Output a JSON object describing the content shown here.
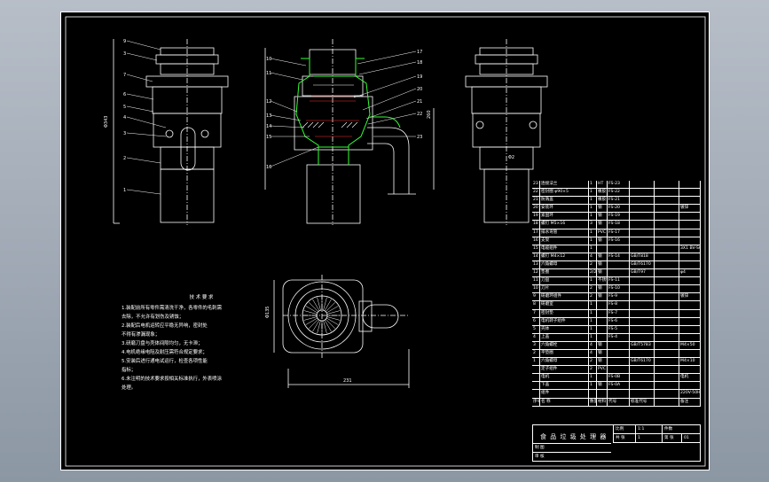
{
  "notes": {
    "title": "技 术 要 求",
    "lines": [
      "1.装配前所有零件需清洗干净，各零件的毛刺需",
      "去除，不允许有划伤及锈蚀；",
      "2.装配后电机运转应平稳无异响，密封处",
      "不得有渗漏现象；",
      "3.研磨刀盘与壳体间隙均匀，无卡滞；",
      "4.电机绝缘电阻及耐压需符合规定要求；",
      "5.安装后进行通电试运行，检查各项性能",
      "指标；",
      "6.未注明的技术要求按相关标准执行，外表喷涂",
      "处理。"
    ]
  },
  "bom": [
    {
      "no": "23",
      "name": "连接法兰",
      "qty": "1",
      "mat": "HT",
      "code": "FS-23",
      "std": "",
      "weight": "",
      "note": ""
    },
    {
      "no": "22",
      "name": "密封圈 φ90×5",
      "qty": "1",
      "mat": "橡胶",
      "code": "FS-22",
      "std": "",
      "weight": "",
      "note": ""
    },
    {
      "no": "21",
      "name": "防溅盖",
      "qty": "1",
      "mat": "橡胶",
      "code": "FS-21",
      "std": "",
      "weight": "",
      "note": ""
    },
    {
      "no": "20",
      "name": "安装环",
      "qty": "1",
      "mat": "钢",
      "code": "FS-20",
      "std": "",
      "weight": "",
      "note": "镀锌"
    },
    {
      "no": "19",
      "name": "紧固环",
      "qty": "1",
      "mat": "钢",
      "code": "FS-19",
      "std": "",
      "weight": "",
      "note": ""
    },
    {
      "no": "18",
      "name": "螺钉 M5×16",
      "qty": "3",
      "mat": "钢",
      "code": "FS-18",
      "std": "",
      "weight": "",
      "note": ""
    },
    {
      "no": "17",
      "name": "排水弯管",
      "qty": "1",
      "mat": "PVC",
      "code": "FS-17",
      "std": "",
      "weight": "",
      "note": ""
    },
    {
      "no": "16",
      "name": "支架",
      "qty": "1",
      "mat": "钢",
      "code": "FS-16",
      "std": "",
      "weight": "",
      "note": ""
    },
    {
      "no": "15",
      "name": "电缆组件",
      "qty": "1",
      "mat": "",
      "code": "",
      "std": "",
      "weight": "",
      "note": "3X1 BV-SGNTC"
    },
    {
      "no": "14",
      "name": "螺钉 M4×12",
      "qty": "4",
      "mat": "钢",
      "code": "FS-14",
      "std": "GB/T818",
      "weight": "",
      "note": ""
    },
    {
      "no": "13",
      "name": "六角螺母",
      "qty": "2",
      "mat": "钢",
      "code": "",
      "std": "GB/T6170",
      "weight": "",
      "note": ""
    },
    {
      "no": "12",
      "name": "垫圈",
      "qty": "2/2",
      "mat": "钢",
      "code": "",
      "std": "GB/T97",
      "weight": "",
      "note": "φ4"
    },
    {
      "no": "11",
      "name": "刀盘",
      "qty": "1",
      "mat": "不锈钢",
      "code": "FS-11",
      "std": "",
      "weight": "",
      "note": ""
    },
    {
      "no": "10",
      "name": "刀片",
      "qty": "2",
      "mat": "钢",
      "code": "FS-10",
      "std": "",
      "weight": "",
      "note": ""
    },
    {
      "no": "9",
      "name": "研磨环组件",
      "qty": "2",
      "mat": "钢",
      "code": "FS-9",
      "std": "",
      "weight": "",
      "note": "镀锌"
    },
    {
      "no": "8",
      "name": "研磨室",
      "qty": "1",
      "mat": "",
      "code": "FS-8",
      "std": "",
      "weight": "",
      "note": ""
    },
    {
      "no": "7",
      "name": "密封垫",
      "qty": "1",
      "mat": "",
      "code": "FS-7",
      "std": "",
      "weight": "",
      "note": ""
    },
    {
      "no": "6",
      "name": "电机转子组件",
      "qty": "1",
      "mat": "",
      "code": "FS-6",
      "std": "",
      "weight": "",
      "note": ""
    },
    {
      "no": "5",
      "name": "壳体",
      "qty": "1",
      "mat": "",
      "code": "FS-5",
      "std": "",
      "weight": "",
      "note": ""
    },
    {
      "no": "4",
      "name": "上盖",
      "qty": "1",
      "mat": "",
      "code": "FS-4",
      "std": "",
      "weight": "",
      "note": ""
    },
    {
      "no": "3",
      "name": "六角螺栓",
      "qty": "4",
      "mat": "钢",
      "code": "",
      "std": "GB/T5783",
      "weight": "",
      "note": "M4×50"
    },
    {
      "no": "2",
      "name": "平垫圈",
      "qty": "4",
      "mat": "钢",
      "code": "",
      "std": "",
      "weight": "",
      "note": ""
    },
    {
      "no": "1",
      "name": "六角螺母",
      "qty": "2",
      "mat": "钢",
      "code": "",
      "std": "GB/T6170",
      "weight": "",
      "note": "M4×10"
    },
    {
      "no": "",
      "name": "定子组件",
      "qty": "2",
      "mat": "PVC",
      "code": "",
      "std": "",
      "weight": "",
      "note": ""
    },
    {
      "no": "",
      "name": "电机",
      "qty": "1",
      "mat": "",
      "code": "FS-0B",
      "std": "",
      "weight": "",
      "note": "电机"
    },
    {
      "no": "",
      "name": "下盖",
      "qty": "1",
      "mat": "钢",
      "code": "FS-0A",
      "std": "",
      "weight": "",
      "note": ""
    },
    {
      "no": "",
      "name": "组件",
      "qty": "",
      "mat": "",
      "code": "",
      "std": "",
      "weight": "",
      "note": "220V-50Hz 370W"
    },
    {
      "no": "序号",
      "name": "名    称",
      "qty": "数量",
      "mat": "材料",
      "code": "代号",
      "std": "标准代号",
      "weight": "",
      "note": "备注"
    }
  ],
  "title_block": {
    "name": "食 品 垃 圾 处 理 器",
    "scale_label": "比例",
    "scale": "1:1",
    "sheet_label": "件数",
    "qty_label": "共  张",
    "qty": "1",
    "sheet_no_label": "第  张",
    "sheet_no": "01",
    "drawn": "制 图",
    "checked": "审 核"
  },
  "labels": {
    "left_view": [
      "9",
      "3",
      "7",
      "6",
      "5",
      "4",
      "3",
      "2",
      "1"
    ],
    "section": [
      "10",
      "11",
      "12",
      "13",
      "14",
      "15",
      "16",
      "17",
      "18",
      "19",
      "20",
      "21",
      "22",
      "23"
    ],
    "dim_height": "Φ343",
    "dim_top": "Φ135",
    "dim_width": "231",
    "dim_height2": "260",
    "dim_right": "Φ2"
  },
  "colors": {
    "line": "#ffffff",
    "section": "#33ff33",
    "hatch": "#ff2222",
    "accent": "#ffff00"
  }
}
